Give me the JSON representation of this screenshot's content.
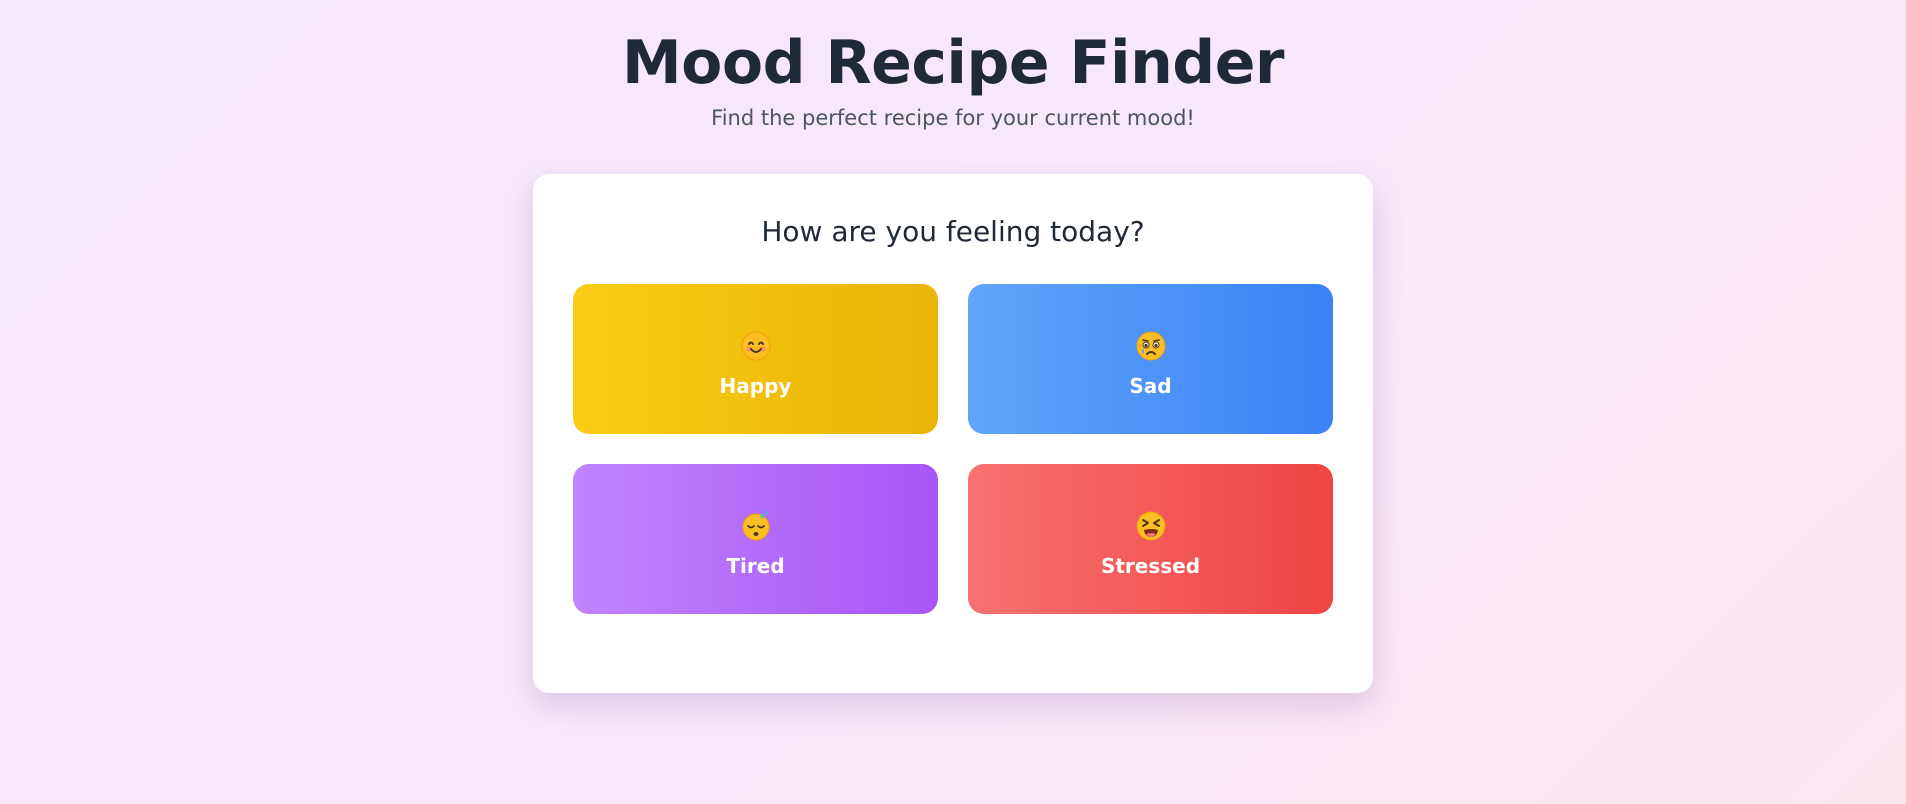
{
  "header": {
    "title": "Mood Recipe Finder",
    "subtitle": "Find the perfect recipe for your current mood!"
  },
  "card": {
    "question": "How are you feeling today?",
    "moods": [
      {
        "label": "Happy",
        "icon": "smiling-face-icon",
        "colors": [
          "#facc15",
          "#eab308"
        ]
      },
      {
        "label": "Sad",
        "icon": "crying-face-icon",
        "colors": [
          "#60a5fa",
          "#3b82f6"
        ]
      },
      {
        "label": "Tired",
        "icon": "sleeping-face-icon",
        "colors": [
          "#c084fc",
          "#a855f7"
        ]
      },
      {
        "label": "Stressed",
        "icon": "tired-face-icon",
        "colors": [
          "#f87171",
          "#ef4444"
        ]
      }
    ]
  }
}
